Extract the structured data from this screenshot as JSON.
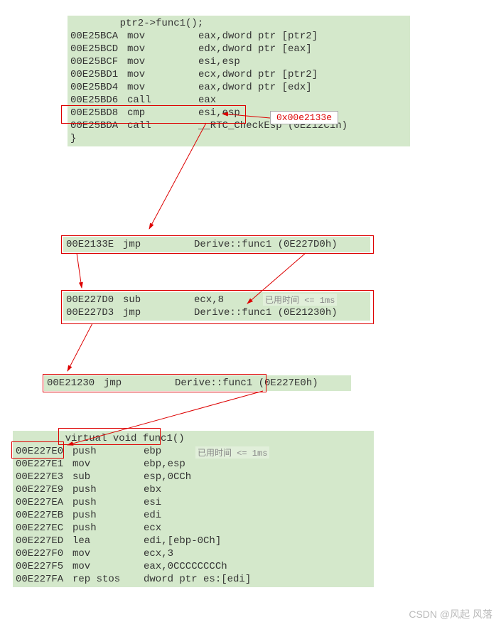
{
  "block1": {
    "title": "    ptr2->func1();",
    "rows": [
      {
        "addr": "00E25BCA",
        "mnem": "mov",
        "op": "eax,dword ptr [ptr2]"
      },
      {
        "addr": "00E25BCD",
        "mnem": "mov",
        "op": "edx,dword ptr [eax]"
      },
      {
        "addr": "00E25BCF",
        "mnem": "mov",
        "op": "esi,esp"
      },
      {
        "addr": "00E25BD1",
        "mnem": "mov",
        "op": "ecx,dword ptr [ptr2]"
      },
      {
        "addr": "00E25BD4",
        "mnem": "mov",
        "op": "eax,dword ptr [edx]"
      },
      {
        "addr": "00E25BD6",
        "mnem": "call",
        "op": "eax"
      },
      {
        "addr": "00E25BD8",
        "mnem": "cmp",
        "op": "esi,esp"
      },
      {
        "addr": "00E25BDA",
        "mnem": "call",
        "op": "__RTC_CheckEsp (0E212C1h)"
      }
    ],
    "brace": "}"
  },
  "popup": {
    "value": "0x00e2133e"
  },
  "block2": {
    "rows": [
      {
        "addr": "00E2133E",
        "mnem": "jmp",
        "op": "Derive::func1 (0E227D0h)"
      }
    ]
  },
  "block3": {
    "rows": [
      {
        "addr": "00E227D0",
        "mnem": "sub",
        "op": "ecx,8"
      },
      {
        "addr": "00E227D3",
        "mnem": "jmp",
        "op": "Derive::func1 (0E21230h)"
      }
    ]
  },
  "tip3": "已用时间 <= 1ms",
  "block4": {
    "rows": [
      {
        "addr": "00E21230",
        "mnem": "jmp",
        "op": "Derive::func1 (0E227E0h)"
      }
    ]
  },
  "block5": {
    "title": "    virtual void func1()",
    "rows": [
      {
        "addr": "00E227E0",
        "mnem": "push",
        "op": "ebp"
      },
      {
        "addr": "00E227E1",
        "mnem": "mov",
        "op": "ebp,esp"
      },
      {
        "addr": "00E227E3",
        "mnem": "sub",
        "op": "esp,0CCh"
      },
      {
        "addr": "00E227E9",
        "mnem": "push",
        "op": "ebx"
      },
      {
        "addr": "00E227EA",
        "mnem": "push",
        "op": "esi"
      },
      {
        "addr": "00E227EB",
        "mnem": "push",
        "op": "edi"
      },
      {
        "addr": "00E227EC",
        "mnem": "push",
        "op": "ecx"
      },
      {
        "addr": "00E227ED",
        "mnem": "lea",
        "op": "edi,[ebp-0Ch]"
      },
      {
        "addr": "00E227F0",
        "mnem": "mov",
        "op": "ecx,3"
      },
      {
        "addr": "00E227F5",
        "mnem": "mov",
        "op": "eax,0CCCCCCCCh"
      },
      {
        "addr": "00E227FA",
        "mnem": "rep stos",
        "op": "dword ptr es:[edi]"
      }
    ]
  },
  "tip5": "已用时间 <= 1ms",
  "watermark": "CSDN @风起 风落"
}
